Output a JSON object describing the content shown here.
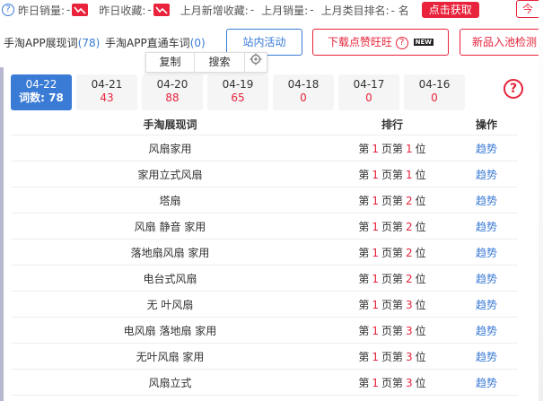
{
  "topbar": {
    "help_glyph": "?",
    "stats": [
      {
        "label": "昨日销量:",
        "value": "-",
        "trend": true
      },
      {
        "label": "昨日收藏:",
        "value": "-",
        "trend": true
      },
      {
        "label": "上月新增收藏:",
        "value": "-",
        "trend": false
      },
      {
        "label": "上月销量:",
        "value": "-",
        "trend": false
      },
      {
        "label": "上月类目排名:",
        "value": "- 名",
        "trend": false
      }
    ],
    "fetch_label": "点击获取",
    "right_stub": "今"
  },
  "row2": {
    "tab1_label": "手淘APP展现词",
    "tab1_count": "(78)",
    "tab2_label": "手淘APP直通车词",
    "tab2_count": "(0)",
    "site_activity": "站内活动",
    "download_label": "下载点赞旺旺",
    "new_badge": "NEW",
    "new_product": "新品入池检测"
  },
  "context_menu": {
    "copy": "复制",
    "search": "搜索"
  },
  "dates": [
    {
      "date": "04-22",
      "value": "词数: 78",
      "active": true
    },
    {
      "date": "04-21",
      "value": "43",
      "active": false
    },
    {
      "date": "04-20",
      "value": "88",
      "active": false
    },
    {
      "date": "04-19",
      "value": "65",
      "active": false
    },
    {
      "date": "04-18",
      "value": "0",
      "active": false
    },
    {
      "date": "04-17",
      "value": "0",
      "active": false
    },
    {
      "date": "04-16",
      "value": "0",
      "active": false
    }
  ],
  "help_big": "?",
  "table": {
    "headers": [
      "手淘展现词",
      "排行",
      "操作"
    ],
    "rank_words": {
      "di": "第",
      "page": "页",
      "pos": "位"
    },
    "action_label": "趋势",
    "rows": [
      {
        "keyword": "风扇家用",
        "page": "1",
        "pos": "1"
      },
      {
        "keyword": "家用立式风扇",
        "page": "1",
        "pos": "1"
      },
      {
        "keyword": "塔扇",
        "page": "1",
        "pos": "2"
      },
      {
        "keyword": "风扇 静音 家用",
        "page": "1",
        "pos": "2"
      },
      {
        "keyword": "落地扇风扇 家用",
        "page": "1",
        "pos": "2"
      },
      {
        "keyword": "电台式风扇",
        "page": "1",
        "pos": "2"
      },
      {
        "keyword": "无 叶风扇",
        "page": "1",
        "pos": "3"
      },
      {
        "keyword": "电风扇 落地扇 家用",
        "page": "1",
        "pos": "3"
      },
      {
        "keyword": "无叶风扇 家用",
        "page": "1",
        "pos": "3"
      },
      {
        "keyword": "风扇立式",
        "page": "1",
        "pos": "3"
      }
    ]
  },
  "colors": {
    "accent": "#3a7bd5",
    "red": "#e8233b"
  }
}
